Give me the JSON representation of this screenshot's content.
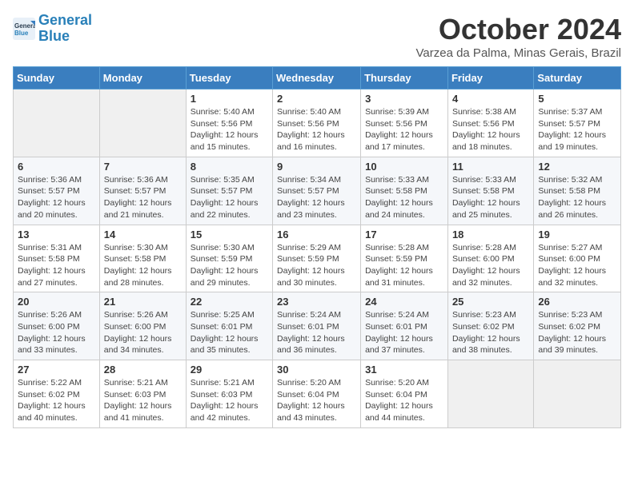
{
  "header": {
    "logo_line1": "General",
    "logo_line2": "Blue",
    "month_title": "October 2024",
    "location": "Varzea da Palma, Minas Gerais, Brazil"
  },
  "days_of_week": [
    "Sunday",
    "Monday",
    "Tuesday",
    "Wednesday",
    "Thursday",
    "Friday",
    "Saturday"
  ],
  "weeks": [
    [
      {
        "num": "",
        "empty": true
      },
      {
        "num": "",
        "empty": true
      },
      {
        "num": "1",
        "sunrise": "5:40 AM",
        "sunset": "5:56 PM",
        "daylight": "12 hours and 15 minutes."
      },
      {
        "num": "2",
        "sunrise": "5:40 AM",
        "sunset": "5:56 PM",
        "daylight": "12 hours and 16 minutes."
      },
      {
        "num": "3",
        "sunrise": "5:39 AM",
        "sunset": "5:56 PM",
        "daylight": "12 hours and 17 minutes."
      },
      {
        "num": "4",
        "sunrise": "5:38 AM",
        "sunset": "5:56 PM",
        "daylight": "12 hours and 18 minutes."
      },
      {
        "num": "5",
        "sunrise": "5:37 AM",
        "sunset": "5:57 PM",
        "daylight": "12 hours and 19 minutes."
      }
    ],
    [
      {
        "num": "6",
        "sunrise": "5:36 AM",
        "sunset": "5:57 PM",
        "daylight": "12 hours and 20 minutes."
      },
      {
        "num": "7",
        "sunrise": "5:36 AM",
        "sunset": "5:57 PM",
        "daylight": "12 hours and 21 minutes."
      },
      {
        "num": "8",
        "sunrise": "5:35 AM",
        "sunset": "5:57 PM",
        "daylight": "12 hours and 22 minutes."
      },
      {
        "num": "9",
        "sunrise": "5:34 AM",
        "sunset": "5:57 PM",
        "daylight": "12 hours and 23 minutes."
      },
      {
        "num": "10",
        "sunrise": "5:33 AM",
        "sunset": "5:58 PM",
        "daylight": "12 hours and 24 minutes."
      },
      {
        "num": "11",
        "sunrise": "5:33 AM",
        "sunset": "5:58 PM",
        "daylight": "12 hours and 25 minutes."
      },
      {
        "num": "12",
        "sunrise": "5:32 AM",
        "sunset": "5:58 PM",
        "daylight": "12 hours and 26 minutes."
      }
    ],
    [
      {
        "num": "13",
        "sunrise": "5:31 AM",
        "sunset": "5:58 PM",
        "daylight": "12 hours and 27 minutes."
      },
      {
        "num": "14",
        "sunrise": "5:30 AM",
        "sunset": "5:58 PM",
        "daylight": "12 hours and 28 minutes."
      },
      {
        "num": "15",
        "sunrise": "5:30 AM",
        "sunset": "5:59 PM",
        "daylight": "12 hours and 29 minutes."
      },
      {
        "num": "16",
        "sunrise": "5:29 AM",
        "sunset": "5:59 PM",
        "daylight": "12 hours and 30 minutes."
      },
      {
        "num": "17",
        "sunrise": "5:28 AM",
        "sunset": "5:59 PM",
        "daylight": "12 hours and 31 minutes."
      },
      {
        "num": "18",
        "sunrise": "5:28 AM",
        "sunset": "6:00 PM",
        "daylight": "12 hours and 32 minutes."
      },
      {
        "num": "19",
        "sunrise": "5:27 AM",
        "sunset": "6:00 PM",
        "daylight": "12 hours and 32 minutes."
      }
    ],
    [
      {
        "num": "20",
        "sunrise": "5:26 AM",
        "sunset": "6:00 PM",
        "daylight": "12 hours and 33 minutes."
      },
      {
        "num": "21",
        "sunrise": "5:26 AM",
        "sunset": "6:00 PM",
        "daylight": "12 hours and 34 minutes."
      },
      {
        "num": "22",
        "sunrise": "5:25 AM",
        "sunset": "6:01 PM",
        "daylight": "12 hours and 35 minutes."
      },
      {
        "num": "23",
        "sunrise": "5:24 AM",
        "sunset": "6:01 PM",
        "daylight": "12 hours and 36 minutes."
      },
      {
        "num": "24",
        "sunrise": "5:24 AM",
        "sunset": "6:01 PM",
        "daylight": "12 hours and 37 minutes."
      },
      {
        "num": "25",
        "sunrise": "5:23 AM",
        "sunset": "6:02 PM",
        "daylight": "12 hours and 38 minutes."
      },
      {
        "num": "26",
        "sunrise": "5:23 AM",
        "sunset": "6:02 PM",
        "daylight": "12 hours and 39 minutes."
      }
    ],
    [
      {
        "num": "27",
        "sunrise": "5:22 AM",
        "sunset": "6:02 PM",
        "daylight": "12 hours and 40 minutes."
      },
      {
        "num": "28",
        "sunrise": "5:21 AM",
        "sunset": "6:03 PM",
        "daylight": "12 hours and 41 minutes."
      },
      {
        "num": "29",
        "sunrise": "5:21 AM",
        "sunset": "6:03 PM",
        "daylight": "12 hours and 42 minutes."
      },
      {
        "num": "30",
        "sunrise": "5:20 AM",
        "sunset": "6:04 PM",
        "daylight": "12 hours and 43 minutes."
      },
      {
        "num": "31",
        "sunrise": "5:20 AM",
        "sunset": "6:04 PM",
        "daylight": "12 hours and 44 minutes."
      },
      {
        "num": "",
        "empty": true
      },
      {
        "num": "",
        "empty": true
      }
    ]
  ],
  "labels": {
    "sunrise": "Sunrise:",
    "sunset": "Sunset:",
    "daylight": "Daylight:"
  }
}
